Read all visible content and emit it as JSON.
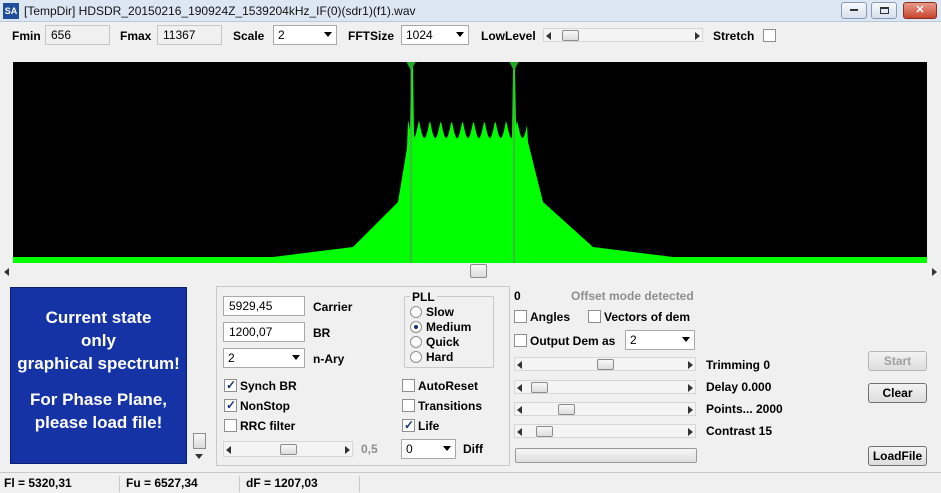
{
  "window": {
    "icon": "SA",
    "title": "[TempDir] HDSDR_20150216_190924Z_1539204kHz_IF(0)(sdr1)(f1).wav",
    "minimize": "▭",
    "restore": "▭",
    "close": "✕"
  },
  "toolbar": {
    "fmin_label": "Fmin",
    "fmin_value": "656",
    "fmax_label": "Fmax",
    "fmax_value": "11367",
    "scale_label": "Scale",
    "scale_value": "2",
    "fftsize_label": "FFTSize",
    "fftsize_value": "1024",
    "lowlevel_label": "LowLevel",
    "stretch_label": "Stretch",
    "stretch_checked": false
  },
  "spectrum": {
    "trace_color": "#00ff00",
    "background": "#000000",
    "marker_color": "#1fa82a"
  },
  "info_panel": {
    "line1": "Current state",
    "line2": "only",
    "line3": "graphical spectrum!",
    "line4": "For Phase Plane,",
    "line5": "please load file!"
  },
  "params": {
    "carrier_value": "5929,45",
    "carrier_label": "Carrier",
    "br_value": "1200,07",
    "br_label": "BR",
    "nary_value": "2",
    "nary_label": "n-Ary",
    "synch_br_label": "Synch BR",
    "synch_br_checked": true,
    "nonstop_label": "NonStop",
    "nonstop_checked": true,
    "rrc_label": "RRC filter",
    "rrc_checked": false,
    "rrc_slider_value": "0,5"
  },
  "pll": {
    "title": "PLL",
    "options": [
      "Slow",
      "Medium",
      "Quick",
      "Hard"
    ],
    "selected": "Medium",
    "autoreset_label": "AutoReset",
    "transitions_label": "Transitions",
    "life_label": "Life",
    "life_checked": true,
    "diff_value": "0",
    "diff_label": "Diff"
  },
  "right": {
    "offset_count": "0",
    "offset_text": "Offset mode detected",
    "angles_label": "Angles",
    "vectors_label": "Vectors of dem",
    "output_dem_label": "Output Dem as",
    "output_dem_value": "2",
    "trimming_label": "Trimming 0",
    "delay_label": "Delay  0.000",
    "points_label": "Points... 2000",
    "contrast_label": "Contrast 15",
    "start_label": "Start",
    "clear_label": "Clear",
    "loadfile_label": "LoadFile"
  },
  "status": {
    "fl": "Fl = 5320,31",
    "fu": "Fu = 6527,34",
    "df": "dF = 1207,03"
  }
}
